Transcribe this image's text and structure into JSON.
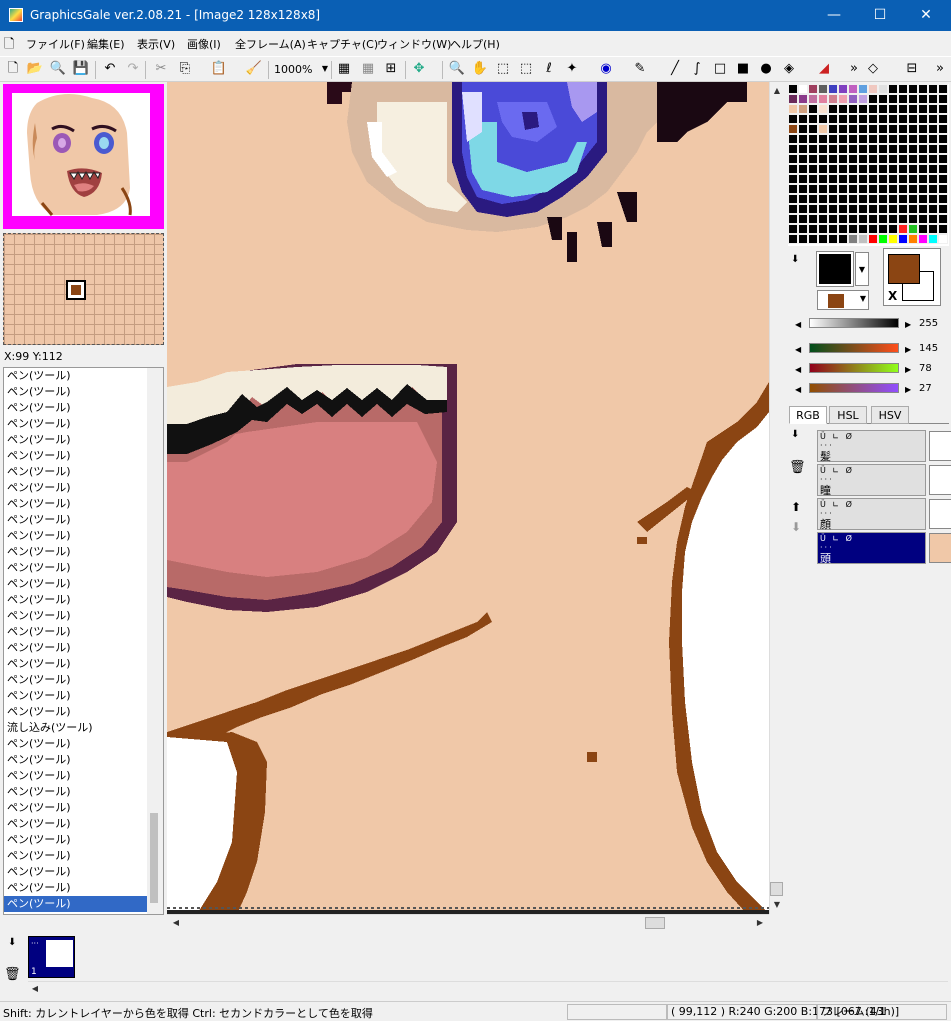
{
  "titlebar": {
    "title": "GraphicsGale ver.2.08.21 - [Image2 128x128x8]",
    "minimize": "—",
    "maximize": "☐",
    "close": "✕"
  },
  "menu": {
    "items": [
      "ファイル(F)",
      "編集(E)",
      "表示(V)",
      "画像(I)",
      "全フレーム(A)",
      "キャプチャ(C)",
      "ウィンドウ(W)",
      "ヘルプ(H)"
    ]
  },
  "toolbar": {
    "zoom": "1000%"
  },
  "navigator": {
    "coords": "X:99 Y:112"
  },
  "history": {
    "items": [
      "ペン(ツール)",
      "ペン(ツール)",
      "ペン(ツール)",
      "ペン(ツール)",
      "ペン(ツール)",
      "ペン(ツール)",
      "ペン(ツール)",
      "ペン(ツール)",
      "ペン(ツール)",
      "ペン(ツール)",
      "ペン(ツール)",
      "ペン(ツール)",
      "ペン(ツール)",
      "ペン(ツール)",
      "ペン(ツール)",
      "ペン(ツール)",
      "ペン(ツール)",
      "ペン(ツール)",
      "ペン(ツール)",
      "ペン(ツール)",
      "ペン(ツール)",
      "ペン(ツール)",
      "流し込み(ツール)",
      "ペン(ツール)",
      "ペン(ツール)",
      "ペン(ツール)",
      "ペン(ツール)",
      "ペン(ツール)",
      "ペン(ツール)",
      "ペン(ツール)",
      "ペン(ツール)",
      "ペン(ツール)",
      "ペン(ツール)"
    ],
    "selected": "ペン(ツール)"
  },
  "colors": {
    "primary": "#8b4513",
    "secondary": "#ffffff",
    "x_label": "X",
    "gray_value": "255",
    "r": "145",
    "g": "78",
    "b": "27"
  },
  "tabs": [
    "RGB",
    "HSL",
    "HSV"
  ],
  "layers": [
    {
      "name": "髪",
      "selected": false
    },
    {
      "name": "瞳",
      "selected": false
    },
    {
      "name": "顔",
      "selected": false
    },
    {
      "name": "頭",
      "selected": true
    }
  ],
  "frames": {
    "frame_label": "1"
  },
  "status": {
    "hint": "Shift: カレントレイヤーから色を取得  Ctrl: セカンドカラーとして色を取得",
    "pixel": "( 99,112 ) R:240 G:200 B:173  [067 (43h)]",
    "frame": "フレーム:1/1"
  }
}
